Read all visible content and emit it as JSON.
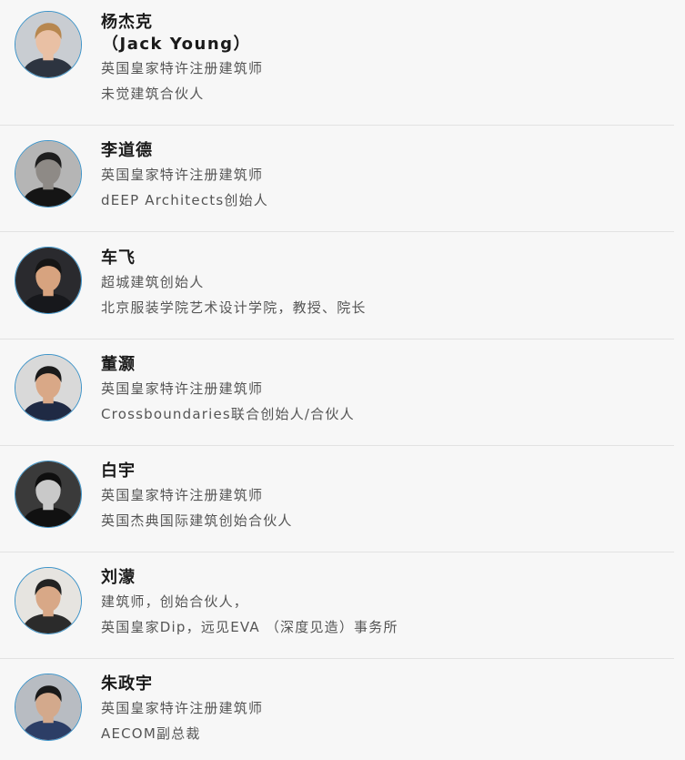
{
  "people": [
    {
      "name": "杨杰克",
      "alt_name": "（Jack Young）",
      "lines": [
        "英国皇家特许注册建筑师",
        "未觉建筑合伙人"
      ],
      "avatar_colors": {
        "bg": "#c9cdd2",
        "skin": "#e9c0a4",
        "hair": "#b7874f",
        "shirt": "#2d3440"
      }
    },
    {
      "name": "李道德",
      "lines": [
        "英国皇家特许注册建筑师",
        "dEEP Architects创始人"
      ],
      "avatar_colors": {
        "bg": "#b5b5b5",
        "skin": "#8e8a86",
        "hair": "#1e1e1e",
        "shirt": "#151515"
      }
    },
    {
      "name": "车飞",
      "lines": [
        "超城建筑创始人",
        "北京服装学院艺术设计学院，教授、院长"
      ],
      "avatar_colors": {
        "bg": "#2a2a2e",
        "skin": "#d7a37f",
        "hair": "#151515",
        "shirt": "#17181c"
      }
    },
    {
      "name": "董灏",
      "lines": [
        "英国皇家特许注册建筑师",
        "Crossboundaries联合创始人/合伙人"
      ],
      "avatar_colors": {
        "bg": "#d9d9d9",
        "skin": "#d9a887",
        "hair": "#1a1a1a",
        "shirt": "#1f2a44"
      }
    },
    {
      "name": "白宇",
      "lines": [
        "英国皇家特许注册建筑师",
        "英国杰典国际建筑创始合伙人"
      ],
      "avatar_colors": {
        "bg": "#3a3a3a",
        "skin": "#c9c9c9",
        "hair": "#0f0f0f",
        "shirt": "#111111"
      }
    },
    {
      "name": "刘濛",
      "lines": [
        "建筑师，创始合伙人，",
        "英国皇家Dip，远见EVA （深度见造）事务所"
      ],
      "avatar_colors": {
        "bg": "#e6e4e0",
        "skin": "#d8a887",
        "hair": "#222222",
        "shirt": "#2b2b2b"
      }
    },
    {
      "name": "朱政宇",
      "lines": [
        "英国皇家特许注册建筑师",
        "AECOM副总裁"
      ],
      "avatar_colors": {
        "bg": "#b8bcc2",
        "skin": "#d3a98c",
        "hair": "#1a1a1a",
        "shirt": "#2c3e66"
      }
    }
  ]
}
